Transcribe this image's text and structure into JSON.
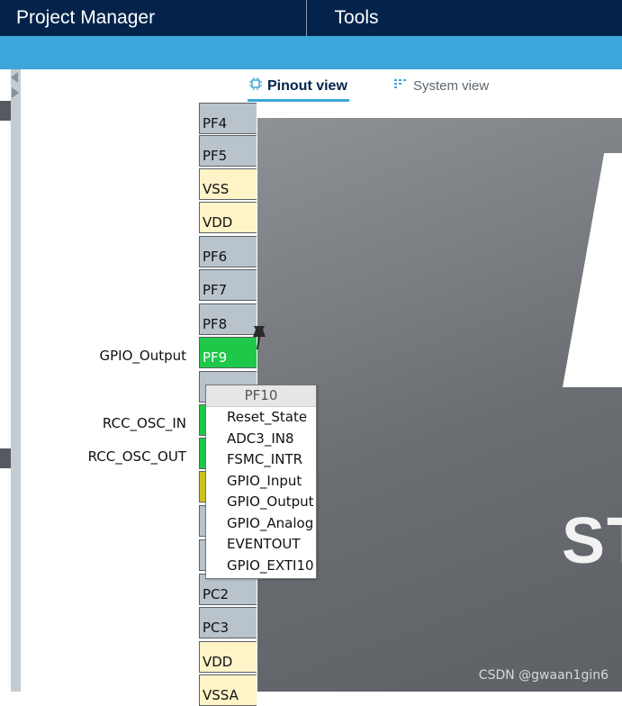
{
  "header": {
    "project_manager": "Project Manager",
    "tools": "Tools"
  },
  "views": {
    "pinout": "Pinout view",
    "system": "System view",
    "pinout_icon": "chip-icon",
    "system_icon": "grid-icon"
  },
  "pins": [
    "PF4",
    "PF5",
    "VSS",
    "VDD",
    "PF6",
    "PF7",
    "PF8",
    "PF9",
    "PC2",
    "PC3",
    "VDD",
    "VSSA"
  ],
  "pin_labels": {
    "pf9": "GPIO_Output",
    "osc_in": "RCC_OSC_IN",
    "osc_out": "RCC_OSC_OUT"
  },
  "menu": {
    "title": "PF10",
    "items": [
      "Reset_State",
      "ADC3_IN8",
      "FSMC_INTR",
      "GPIO_Input",
      "GPIO_Output",
      "GPIO_Analog",
      "EVENTOUT",
      "GPIO_EXTI10"
    ]
  },
  "chip_text": "ST",
  "watermark": "CSDN @gwaan1gin6",
  "colors": {
    "header": "#03234b",
    "accent": "#3ba6d9",
    "pin_green": "#1ec94a",
    "pin_power": "#fff3c8",
    "pin_default": "#b9c3cb"
  }
}
